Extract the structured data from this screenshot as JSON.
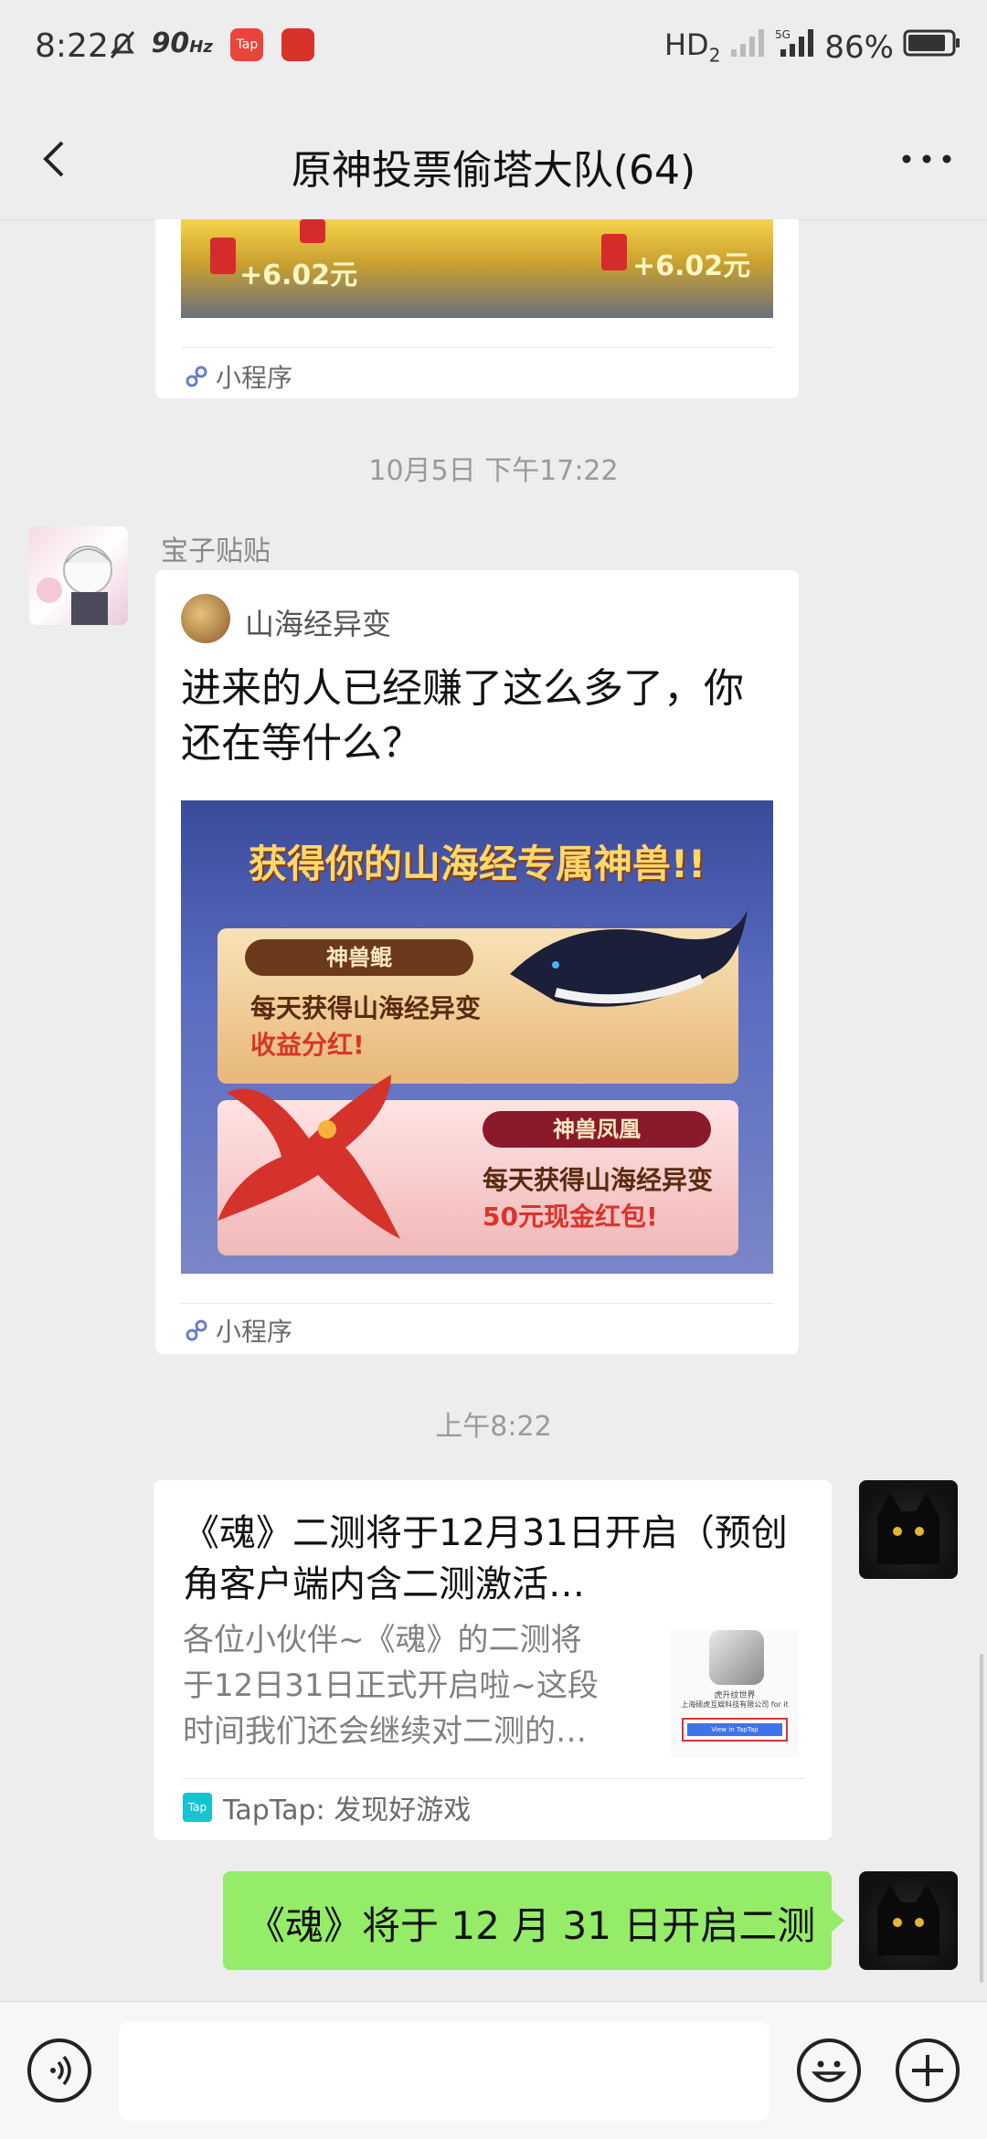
{
  "status_bar": {
    "time": "8:22",
    "left_icons": "⏰̸ 90Hz",
    "right_text": "HD₂ ⁇ 5G 86%",
    "battery_percent": 86,
    "app_badge_1": "Tap",
    "app_badge_2": "app"
  },
  "nav": {
    "title": "原神投票偷塔大队(64)",
    "back_icon": "chevron-left-icon",
    "more_icon": "more-dots-icon"
  },
  "messages": {
    "top_card": {
      "image_text_left": "+6.02元",
      "image_text_right": "+6.02元",
      "footer": "小程序"
    },
    "timestamp_1": "10月5日 下午17:22",
    "sender_name": "宝子贴贴",
    "card2": {
      "app_name": "山海经异变",
      "title": "进来的人已经赚了这么多了，你还在等什么？",
      "banner_headline": "获得你的山海经专属神兽!!",
      "banner_tag_1": "神兽鲲",
      "banner_line_1a": "每天获得山海经异变",
      "banner_line_1b": "收益分红!",
      "banner_tag_2": "神兽凤凰",
      "banner_line_2a": "每天获得山海经异变",
      "banner_line_2b": "50元现金红包!",
      "footer": "小程序"
    },
    "timestamp_2": "上午8:22",
    "link_card": {
      "title": "《魂》二测将于12月31日开启（预创角客户端内含二测激活…",
      "description": "各位小伙伴~《魂》的二测将于12日31日正式开启啦~这段时间我们还会继续对二测的…",
      "thumb_caption_1": "虎升纹世界",
      "thumb_caption_2": "上海硕虎互娱科技有限公司 for it",
      "thumb_button": "View in TapTap",
      "source": "TapTap: 发现好游戏"
    },
    "green_bubble": "《魂》将于 12 月 31 日开启二测"
  },
  "colors": {
    "background": "#ededed",
    "green_bubble": "#95ec69",
    "taptap": "#15c5ce"
  }
}
